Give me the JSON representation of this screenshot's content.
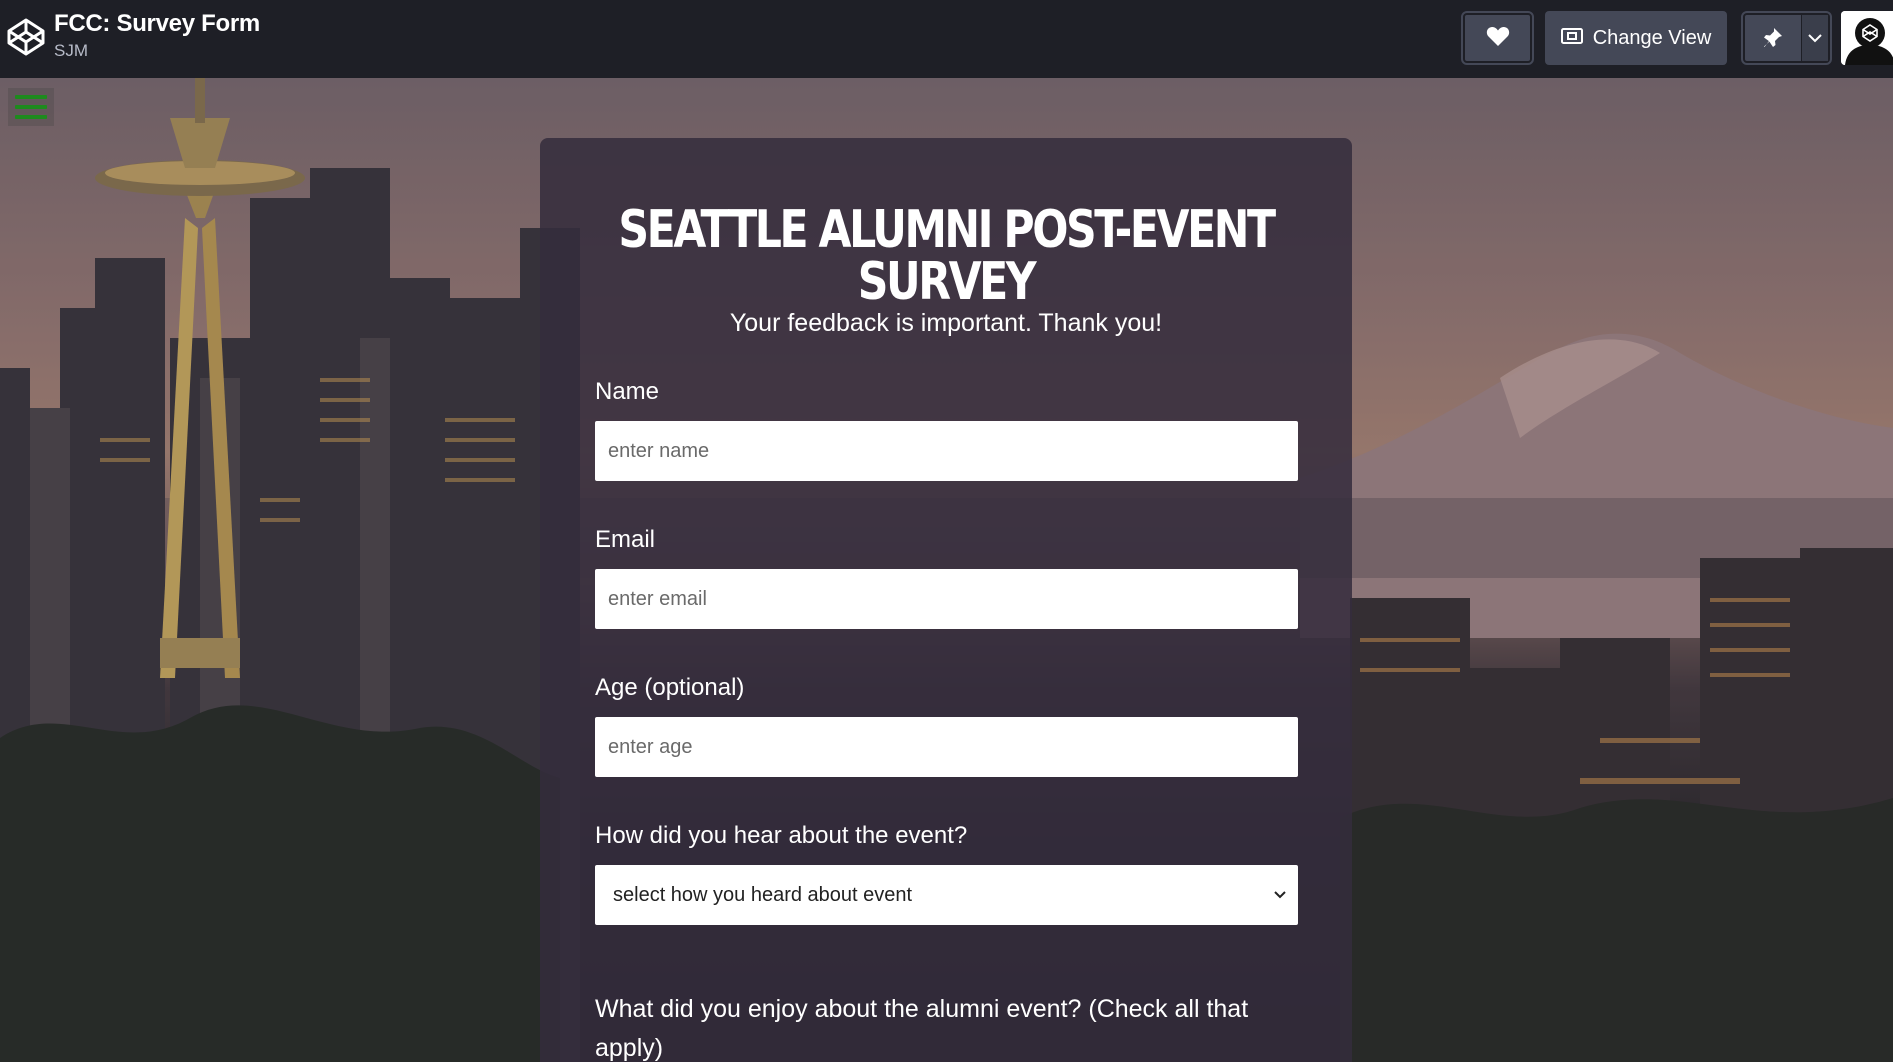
{
  "app": {
    "title": "FCC: Survey Form",
    "author": "SJM",
    "change_view_label": "Change View",
    "icons": [
      "codepen-logo-icon",
      "heart-icon",
      "change-view-icon",
      "pin-icon",
      "chevron-down-icon",
      "avatar"
    ]
  },
  "form": {
    "heading": "SEATTLE ALUMNI POST-EVENT SURVEY",
    "subheading": "Your feedback is important. Thank you!",
    "name_label": "Name",
    "name_placeholder": "enter name",
    "email_label": "Email",
    "email_placeholder": "enter email",
    "age_label": "Age (optional)",
    "age_placeholder": "enter age",
    "referral_label": "How did you hear about the event?",
    "referral_selected": "select how you heard about event",
    "enjoy_question": "What did you enjoy about the alumni event? (Check all that apply)"
  },
  "colors": {
    "topbar": "#1e1f26",
    "button": "#444857",
    "card": "#342c3c",
    "menu_accent": "#1e8a1e"
  }
}
